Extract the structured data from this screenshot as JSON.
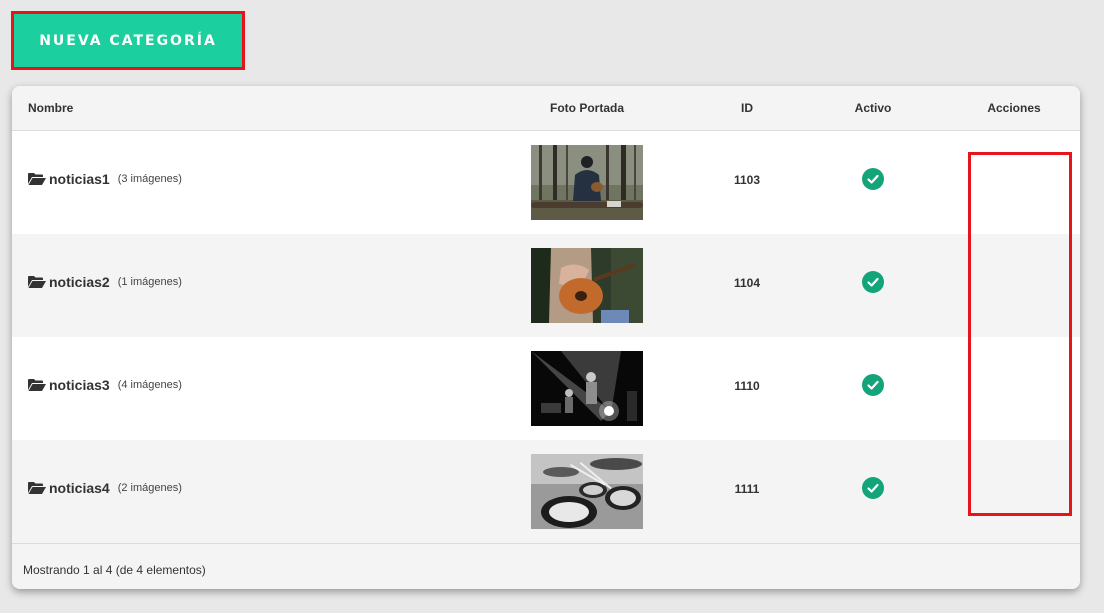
{
  "toolbar": {
    "new_category_label": "NUEVA CATEGORÍA"
  },
  "table": {
    "columns": {
      "name": "Nombre",
      "cover": "Foto Portada",
      "id": "ID",
      "active": "Activo",
      "actions": "Acciones"
    },
    "rows": [
      {
        "name": "noticias1",
        "count": "(3 imágenes)",
        "id": "1103",
        "active": true,
        "cover_icon": "photo-forest-guitarist"
      },
      {
        "name": "noticias2",
        "count": "(1 imágenes)",
        "id": "1104",
        "active": true,
        "cover_icon": "photo-acoustic-guitar"
      },
      {
        "name": "noticias3",
        "count": "(4 imágenes)",
        "id": "1110",
        "active": true,
        "cover_icon": "photo-concert-stage-bw"
      },
      {
        "name": "noticias4",
        "count": "(2 imágenes)",
        "id": "1111",
        "active": true,
        "cover_icon": "photo-drums-bw"
      }
    ],
    "footer_text": "Mostrando 1 al 4 (de 4 elementos)"
  },
  "colors": {
    "accent": "#1ccf9f",
    "active_check": "#13a47a",
    "highlight": "#e8141c"
  }
}
